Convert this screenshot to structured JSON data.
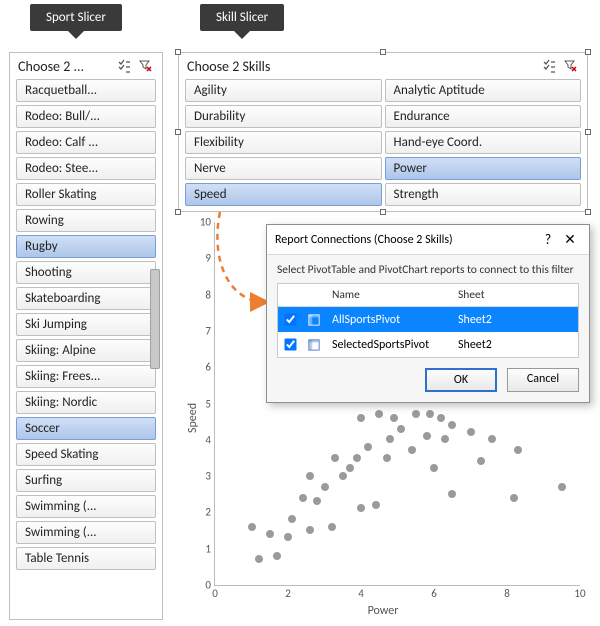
{
  "tags": {
    "sport": "Sport Slicer",
    "skill": "Skill Slicer"
  },
  "sport_slicer": {
    "title": "Choose 2 ...",
    "items": [
      {
        "label": "Racquetball...",
        "selected": false
      },
      {
        "label": "Rodeo: Bull/...",
        "selected": false
      },
      {
        "label": "Rodeo: Calf ...",
        "selected": false
      },
      {
        "label": "Rodeo: Stee...",
        "selected": false
      },
      {
        "label": "Roller Skating",
        "selected": false
      },
      {
        "label": "Rowing",
        "selected": false
      },
      {
        "label": "Rugby",
        "selected": true
      },
      {
        "label": "Shooting",
        "selected": false
      },
      {
        "label": "Skateboarding",
        "selected": false
      },
      {
        "label": "Ski Jumping",
        "selected": false
      },
      {
        "label": "Skiing: Alpine",
        "selected": false
      },
      {
        "label": "Skiing: Frees...",
        "selected": false
      },
      {
        "label": "Skiing: Nordic",
        "selected": false
      },
      {
        "label": "Soccer",
        "selected": true
      },
      {
        "label": "Speed Skating",
        "selected": false
      },
      {
        "label": "Surfing",
        "selected": false
      },
      {
        "label": "Swimming (...",
        "selected": false
      },
      {
        "label": "Swimming (...",
        "selected": false
      },
      {
        "label": "Table Tennis",
        "selected": false
      }
    ]
  },
  "skill_slicer": {
    "title": "Choose 2 Skills",
    "items": [
      {
        "label": "Agility",
        "selected": false
      },
      {
        "label": "Analytic Aptitude",
        "selected": false
      },
      {
        "label": "Durability",
        "selected": false
      },
      {
        "label": "Endurance",
        "selected": false
      },
      {
        "label": "Flexibility",
        "selected": false
      },
      {
        "label": "Hand-eye Coord.",
        "selected": false
      },
      {
        "label": "Nerve",
        "selected": false
      },
      {
        "label": "Power",
        "selected": true
      },
      {
        "label": "Speed",
        "selected": true
      },
      {
        "label": "Strength",
        "selected": false
      }
    ]
  },
  "dialog": {
    "title": "Report Connections (Choose 2 Skills)",
    "hint": "Select PivotTable and PivotChart reports to connect to this filter",
    "columns": {
      "name": "Name",
      "sheet": "Sheet"
    },
    "rows": [
      {
        "checked": true,
        "name": "AllSportsPivot",
        "sheet": "Sheet2",
        "selected": true
      },
      {
        "checked": true,
        "name": "SelectedSportsPivot",
        "sheet": "Sheet2",
        "selected": false
      }
    ],
    "ok": "OK",
    "cancel": "Cancel",
    "help": "?",
    "close": "✕"
  },
  "chart_data": {
    "type": "scatter",
    "xlabel": "Power",
    "ylabel": "Speed",
    "xlim": [
      0,
      10
    ],
    "ylim": [
      0,
      10
    ],
    "xticks": [
      0,
      2,
      4,
      6,
      8,
      10
    ],
    "yticks": [
      0,
      1,
      2,
      3,
      4,
      5,
      6,
      7,
      8,
      9,
      10
    ],
    "points": [
      {
        "x": 1.0,
        "y": 1.5
      },
      {
        "x": 1.2,
        "y": 0.6
      },
      {
        "x": 1.5,
        "y": 1.3
      },
      {
        "x": 1.7,
        "y": 0.7
      },
      {
        "x": 2.0,
        "y": 1.2
      },
      {
        "x": 2.1,
        "y": 1.7
      },
      {
        "x": 2.4,
        "y": 2.3
      },
      {
        "x": 2.6,
        "y": 1.4
      },
      {
        "x": 2.6,
        "y": 2.9
      },
      {
        "x": 2.8,
        "y": 2.2
      },
      {
        "x": 3.0,
        "y": 2.6
      },
      {
        "x": 3.2,
        "y": 1.5
      },
      {
        "x": 3.3,
        "y": 3.4
      },
      {
        "x": 3.5,
        "y": 2.9
      },
      {
        "x": 3.7,
        "y": 3.1
      },
      {
        "x": 3.9,
        "y": 3.4
      },
      {
        "x": 4.0,
        "y": 2.0
      },
      {
        "x": 4.0,
        "y": 4.5
      },
      {
        "x": 4.2,
        "y": 3.7
      },
      {
        "x": 4.4,
        "y": 2.1
      },
      {
        "x": 4.5,
        "y": 4.6
      },
      {
        "x": 4.7,
        "y": 3.4
      },
      {
        "x": 4.8,
        "y": 3.9
      },
      {
        "x": 4.9,
        "y": 4.5
      },
      {
        "x": 5.1,
        "y": 4.2
      },
      {
        "x": 5.4,
        "y": 3.6
      },
      {
        "x": 5.5,
        "y": 4.6
      },
      {
        "x": 5.8,
        "y": 4.0
      },
      {
        "x": 5.9,
        "y": 4.6
      },
      {
        "x": 6.0,
        "y": 3.1
      },
      {
        "x": 6.2,
        "y": 4.5
      },
      {
        "x": 6.3,
        "y": 3.9
      },
      {
        "x": 6.5,
        "y": 2.4
      },
      {
        "x": 6.5,
        "y": 4.3
      },
      {
        "x": 7.0,
        "y": 4.1
      },
      {
        "x": 7.3,
        "y": 3.3
      },
      {
        "x": 7.6,
        "y": 3.9
      },
      {
        "x": 8.2,
        "y": 2.3
      },
      {
        "x": 8.3,
        "y": 3.6
      },
      {
        "x": 9.5,
        "y": 2.6
      }
    ]
  }
}
